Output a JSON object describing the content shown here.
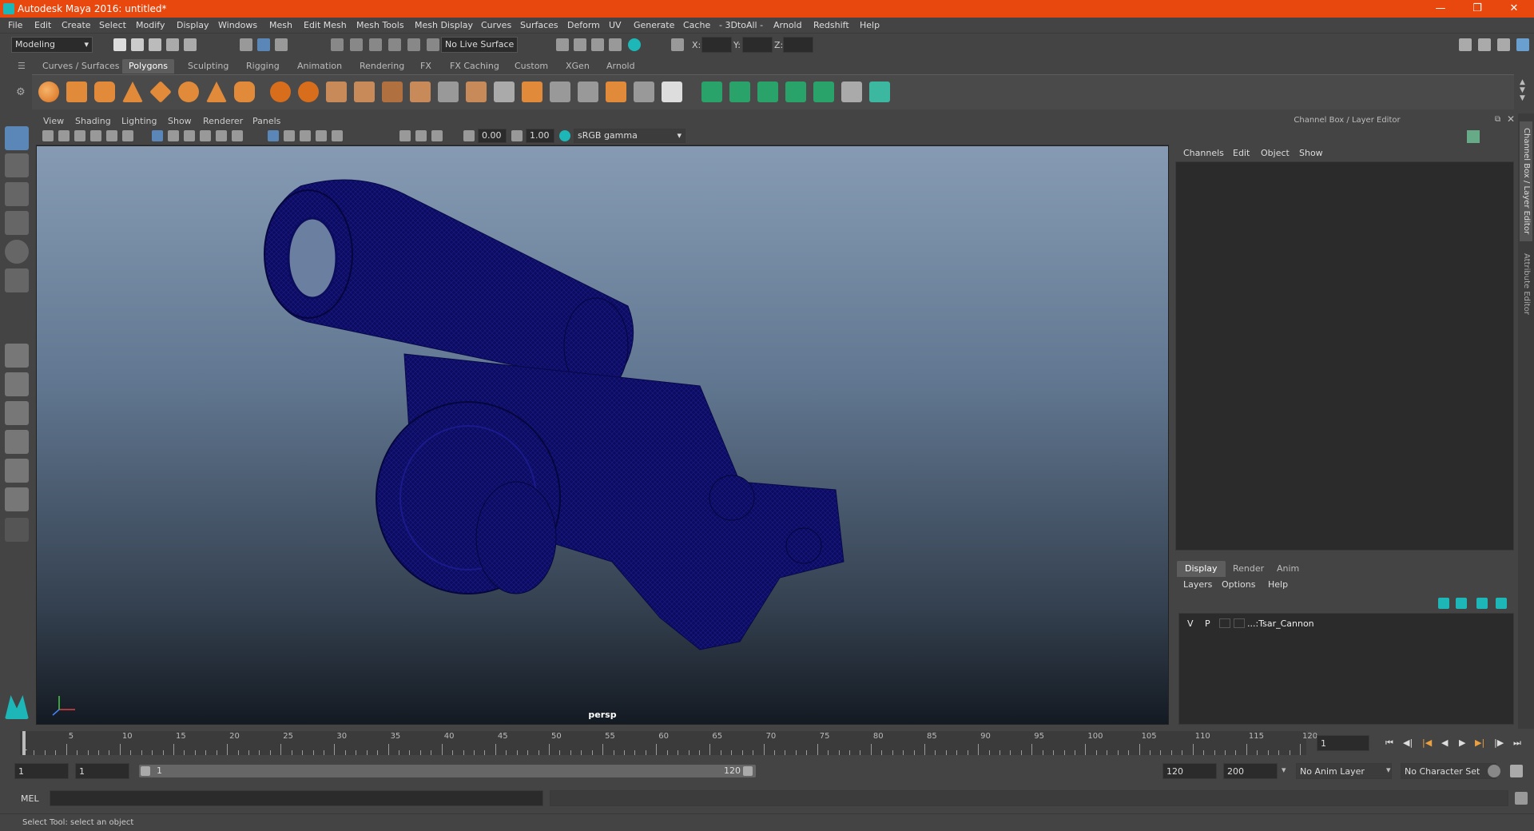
{
  "window": {
    "title": "Autodesk Maya 2016: untitled*"
  },
  "menubar": {
    "items": [
      "File",
      "Edit",
      "Create",
      "Select",
      "Modify",
      "Display",
      "Windows",
      "Mesh",
      "Edit Mesh",
      "Mesh Tools",
      "Mesh Display",
      "Curves",
      "Surfaces",
      "Deform",
      "UV",
      "Generate",
      "Cache",
      "- 3DtoAll -",
      "Arnold",
      "Redshift",
      "Help"
    ]
  },
  "statusline": {
    "mode": "Modeling",
    "live_surface": "No Live Surface",
    "x_label": "X:",
    "y_label": "Y:",
    "z_label": "Z:"
  },
  "shelf": {
    "tabs": [
      "Curves / Surfaces",
      "Polygons",
      "Sculpting",
      "Rigging",
      "Animation",
      "Rendering",
      "FX",
      "FX Caching",
      "Custom",
      "XGen",
      "Arnold"
    ],
    "active_tab": "Polygons"
  },
  "viewport": {
    "menu": [
      "View",
      "Shading",
      "Lighting",
      "Show",
      "Renderer",
      "Panels"
    ],
    "exposure": "0.00",
    "gamma": "1.00",
    "colorspace": "sRGB gamma",
    "camera_label": "persp"
  },
  "channelbox": {
    "title": "Channel Box / Layer Editor",
    "menu": [
      "Channels",
      "Edit",
      "Object",
      "Show"
    ]
  },
  "layereditor": {
    "tabs": [
      "Display",
      "Render",
      "Anim"
    ],
    "active_tab": "Display",
    "menu": [
      "Layers",
      "Options",
      "Help"
    ],
    "layers": [
      {
        "visible": "V",
        "playback": "P",
        "name": "...:Tsar_Cannon"
      }
    ]
  },
  "sidetabs": [
    "Channel Box / Layer Editor",
    "Attribute Editor"
  ],
  "timeline": {
    "ticks": [
      "5",
      "10",
      "15",
      "20",
      "25",
      "30",
      "35",
      "40",
      "45",
      "50",
      "55",
      "60",
      "65",
      "70",
      "75",
      "80",
      "85",
      "90",
      "95",
      "100",
      "105",
      "110",
      "115",
      "120"
    ],
    "start_tick": "1",
    "current_frame": "1"
  },
  "range": {
    "start": "1",
    "anim_start": "1",
    "slider_start": "1",
    "slider_end": "120",
    "playback_end": "120",
    "anim_end": "200",
    "anim_layer": "No Anim Layer",
    "character_set": "No Character Set"
  },
  "mel": {
    "label": "MEL"
  },
  "helpline": {
    "text": "Select Tool: select an object"
  },
  "colors": {
    "titlebar": "#e8470e",
    "wireframe": "#0c0c5e",
    "accent": "#1db7b7"
  }
}
